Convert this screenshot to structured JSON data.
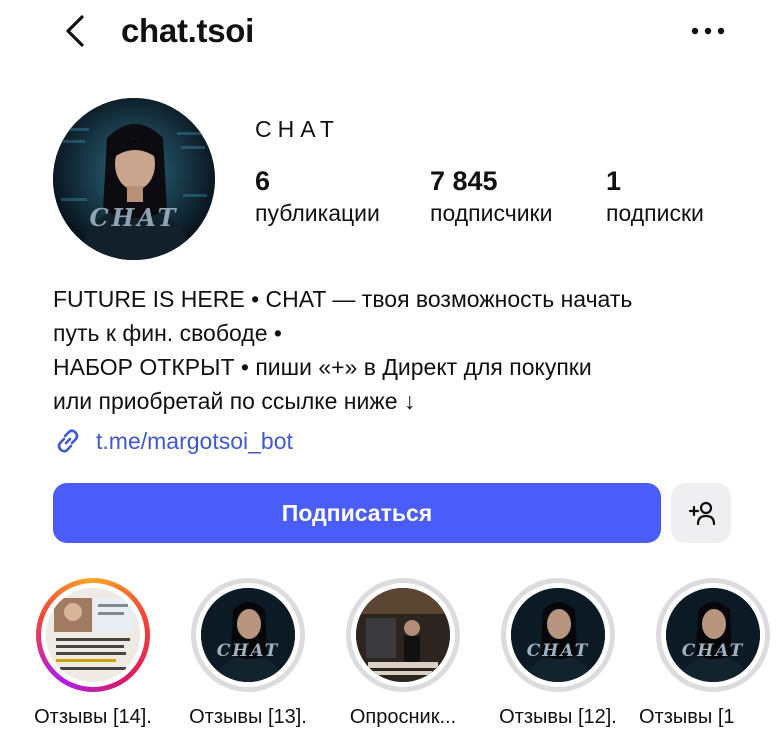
{
  "header": {
    "username": "chat.tsoi"
  },
  "profile": {
    "display_name": "CHAT",
    "avatar_watermark": "CHAT",
    "stats": {
      "posts_value": "6",
      "posts_label": "публикации",
      "followers_value": "7 845",
      "followers_label": "подписчики",
      "following_value": "1",
      "following_label": "подписки"
    },
    "bio": {
      "line1": "FUTURE IS HERE • CHAT — твоя возможность начать",
      "line2": "путь к фин. свободе •",
      "line3": "НАБОР ОТКРЫТ • пиши «+» в Директ для покупки",
      "line4": "или приобретай по ссылке ниже ↓"
    },
    "link": "t.me/margotsoi_bot"
  },
  "actions": {
    "follow_label": "Подписаться"
  },
  "highlights": [
    {
      "label": "Отзывы [14].",
      "thumb": "reviews-photo",
      "active": true
    },
    {
      "label": "Отзывы [13].",
      "thumb": "chat-logo",
      "active": false
    },
    {
      "label": "Опросник...",
      "thumb": "questionnaire-photo",
      "active": false
    },
    {
      "label": "Отзывы [12].",
      "thumb": "chat-logo",
      "active": false
    },
    {
      "label": "Отзывы [1",
      "thumb": "chat-logo",
      "active": false
    }
  ],
  "colors": {
    "accent": "#4a5df8",
    "link": "#3f58d3",
    "secondary_button": "#efeff1",
    "highlight_ring": "#dcdcdf"
  }
}
